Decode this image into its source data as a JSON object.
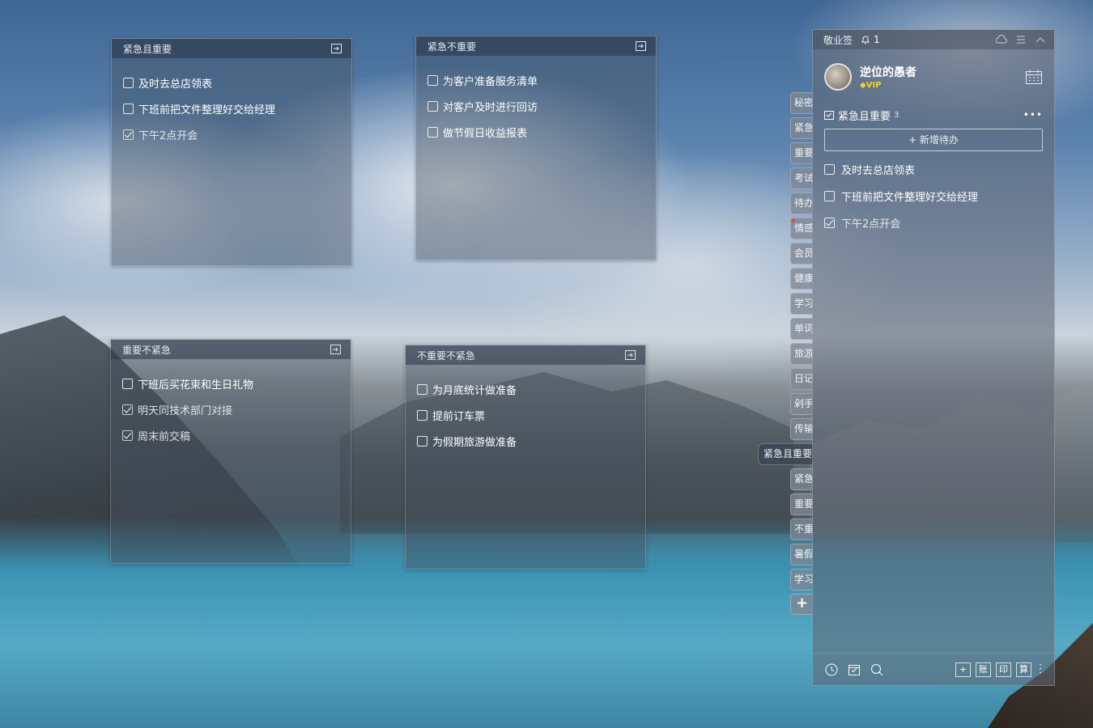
{
  "notes": [
    {
      "title": "紧急且重要",
      "items": [
        {
          "text": "及时去总店领表",
          "done": false
        },
        {
          "text": "下班前把文件整理好交给经理",
          "done": false
        },
        {
          "text": "下午2点开会",
          "done": true
        }
      ]
    },
    {
      "title": "紧急不重要",
      "items": [
        {
          "text": "为客户准备服务清单",
          "done": false
        },
        {
          "text": "对客户及时进行回访",
          "done": false
        },
        {
          "text": "做节假日收益报表",
          "done": false
        }
      ]
    },
    {
      "title": "重要不紧急",
      "items": [
        {
          "text": "下班后买花束和生日礼物",
          "done": false
        },
        {
          "text": "明天同技术部门对接",
          "done": true
        },
        {
          "text": "周末前交稿",
          "done": true
        }
      ]
    },
    {
      "title": "不重要不紧急",
      "items": [
        {
          "text": "为月底统计做准备",
          "done": false
        },
        {
          "text": "提前订车票",
          "done": false
        },
        {
          "text": "为假期旅游做准备",
          "done": false
        }
      ]
    }
  ],
  "tabs": [
    "秘密",
    "紧急",
    "重要",
    "考试",
    "待办",
    "情感",
    "会员",
    "健康",
    "学习",
    "单词",
    "旅游",
    "日记",
    "剁手",
    "传输",
    "紧急且重要",
    "紧急",
    "重要",
    "不重",
    "暑假",
    "学习"
  ],
  "tab_add": "+",
  "panel": {
    "app_title": "敬业签",
    "notif_count": "1",
    "user_name": "逆位的愚者",
    "vip_label": "VIP",
    "category": "紧急且重要",
    "category_count": "3",
    "more": "•••",
    "add_button": "+ 新增待办",
    "items": [
      {
        "text": "及时去总店领表",
        "done": false
      },
      {
        "text": "下班前把文件整理好交给经理",
        "done": false
      },
      {
        "text": "下午2点开会",
        "done": true
      }
    ],
    "bottom_buttons": [
      "+",
      "账",
      "印",
      "算"
    ]
  }
}
